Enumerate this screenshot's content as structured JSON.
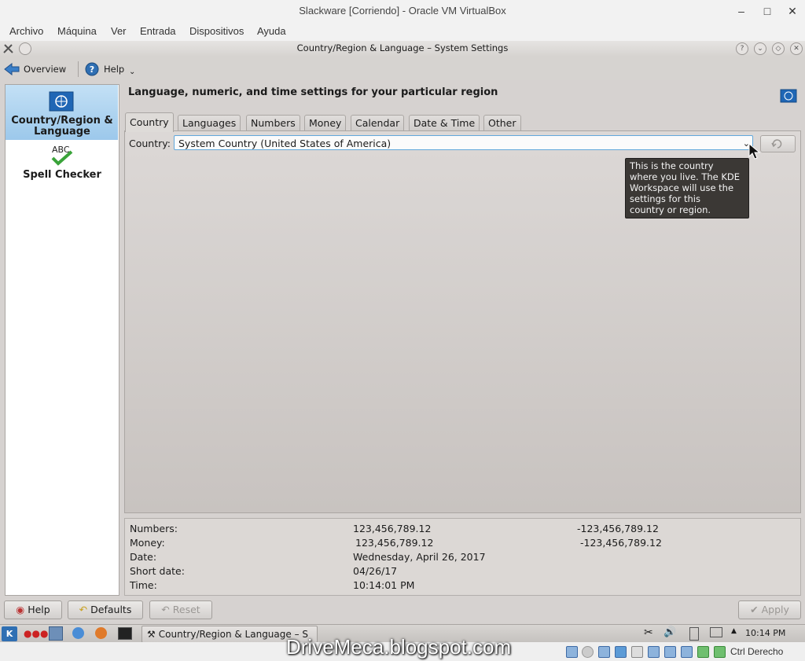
{
  "host": {
    "title": "Slackware [Corriendo] - Oracle VM VirtualBox",
    "menu": [
      "Archivo",
      "Máquina",
      "Ver",
      "Entrada",
      "Dispositivos",
      "Ayuda"
    ],
    "host_key": "Ctrl Derecho"
  },
  "window": {
    "title": "Country/Region & Language – System Settings"
  },
  "toolbar": {
    "overview": "Overview",
    "help": "Help"
  },
  "sidebar": {
    "items": [
      {
        "label": "Country/Region & Language"
      },
      {
        "label": "Spell Checker"
      }
    ]
  },
  "main": {
    "heading": "Language, numeric, and time settings for your particular region",
    "tabs": [
      "Country",
      "Languages",
      "Numbers",
      "Money",
      "Calendar",
      "Date & Time",
      "Other"
    ],
    "country_label": "Country:",
    "country_value": "System Country (United States of America)",
    "tooltip": "This is the country\nwhere you live. The KDE\nWorkspace will use the\nsettings for this\ncountry or region."
  },
  "summary": {
    "numbers_label": "Numbers:",
    "numbers_value": "123,456,789.12",
    "numbers_neg": "-123,456,789.12",
    "money_label": "Money:",
    "money_value": "123,456,789.12",
    "money_neg": "-123,456,789.12",
    "date_label": "Date:",
    "date_value": "Wednesday, April 26, 2017",
    "short_date_label": "Short date:",
    "short_date_value": "04/26/17",
    "time_label": "Time:",
    "time_value": "10:14:01 PM"
  },
  "buttons": {
    "help": "Help",
    "defaults": "Defaults",
    "reset": "Reset",
    "apply": "Apply"
  },
  "taskbar": {
    "task_label": "Country/Region & Language – S",
    "clock": "10:14 PM"
  },
  "watermark": "DriveMeca.blogspot.com",
  "colors": {
    "selection": "#9cc8eb",
    "tooltip_bg": "#3b3835",
    "focus_border": "#62a8db"
  }
}
